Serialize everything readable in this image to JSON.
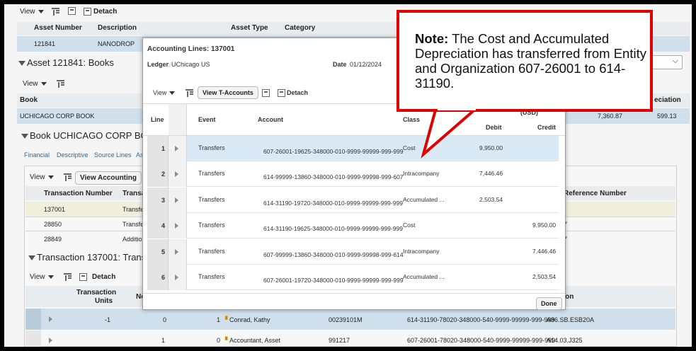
{
  "background": {
    "toolbar1": {
      "view_label": "View",
      "detach_label": "Detach"
    },
    "asset_table": {
      "headers": [
        "Asset Number",
        "Description",
        "Asset Type",
        "Category"
      ],
      "row": {
        "asset_number": "121841",
        "description": "NANODROP"
      }
    },
    "asset_books": {
      "title": "Asset 121841: Books",
      "view_label": "View",
      "book_header": "Book",
      "book_value": "UCHICAGO CORP BOOK",
      "depreciation_header": "eciation",
      "right_values": [
        "7,360.87",
        "599.13"
      ]
    },
    "book_section": {
      "title": "Book UCHICAGO CORP BO",
      "tabs": [
        "Financial",
        "Descriptive",
        "Source Lines",
        "As"
      ]
    },
    "transactions": {
      "view_label": "View",
      "view_accounting_label": "View Accounting",
      "headers": [
        "Transaction Number",
        "Transa",
        "Reference Number"
      ],
      "rows": [
        {
          "number": "137001",
          "type": "Transfe"
        },
        {
          "number": "28850",
          "type": "Transfe"
        },
        {
          "number": "28849",
          "type": "Additio"
        }
      ],
      "right_partials": [
        "7",
        "7"
      ]
    },
    "transaction_section": {
      "title": "Transaction 137001: Transfer",
      "view_label": "View",
      "detach_label": "Detach",
      "headers": {
        "units_1": "Transaction",
        "units_2": "Units",
        "ne": "Ne",
        "tion": "tion"
      },
      "rows": [
        {
          "units": "-1",
          "c2": "0",
          "c3": "1",
          "name": "Conrad, Kathy",
          "code": "00239101M",
          "account": "614-31190-78020-348000-540-9999-99999-999-999",
          "loc": "A86.SB.ESB20A"
        },
        {
          "units": "1",
          "c2": "0",
          "c3": "",
          "name": "Accountant, Asset",
          "code": "991217",
          "account": "607-26001-78020-348000-540-9999-99999-999-999",
          "loc": "A14.03.J325"
        }
      ]
    },
    "dropdown_chevron": "⌵"
  },
  "modal": {
    "title": "Accounting Lines: 137001",
    "ledger_label": "Ledger",
    "ledger_value": "UChicago US",
    "date_label": "Date",
    "date_value": "01/12/2024",
    "toolbar": {
      "view_label": "View",
      "view_t_accounts_label": "View T-Accounts",
      "detach_label": "Detach"
    },
    "columns": {
      "line": "Line",
      "event": "Event",
      "account": "Account",
      "class": "Class",
      "amount_group": "(USD)",
      "debit": "Debit",
      "credit": "Credit"
    },
    "rows": [
      {
        "line": "1",
        "event": "Transfers",
        "account": "607-26001-19625-348000-010-9999-99999-999-999",
        "class": "Cost",
        "debit": "9,950.00",
        "credit": ""
      },
      {
        "line": "2",
        "event": "Transfers",
        "account": "614-99999-13860-348000-010-9999-99998-999-607",
        "class": "Intracompany",
        "debit": "7,446.46",
        "credit": ""
      },
      {
        "line": "3",
        "event": "Transfers",
        "account": "614-31190-19720-348000-010-9999-99999-999-999",
        "class": "Accumulated ...",
        "debit": "2,503.54",
        "credit": ""
      },
      {
        "line": "4",
        "event": "Transfers",
        "account": "614-31190-19625-348000-010-9999-99999-999-999",
        "class": "Cost",
        "debit": "",
        "credit": "9,950.00"
      },
      {
        "line": "5",
        "event": "Transfers",
        "account": "607-99999-13860-348000-010-9999-99998-999-614",
        "class": "Intracompany",
        "debit": "",
        "credit": "7,446.46"
      },
      {
        "line": "6",
        "event": "Transfers",
        "account": "607-26001-19720-348000-010-9999-99999-999-999",
        "class": "Accumulated ...",
        "debit": "",
        "credit": "2,503.54"
      }
    ],
    "done_label": "Done"
  },
  "callout": {
    "note_label": "Note:",
    "text": " The Cost and Accumulated Depreciation has transferred from Entity and Organization 607-26001 to 614-31190.",
    "border_color": "#e00000"
  }
}
